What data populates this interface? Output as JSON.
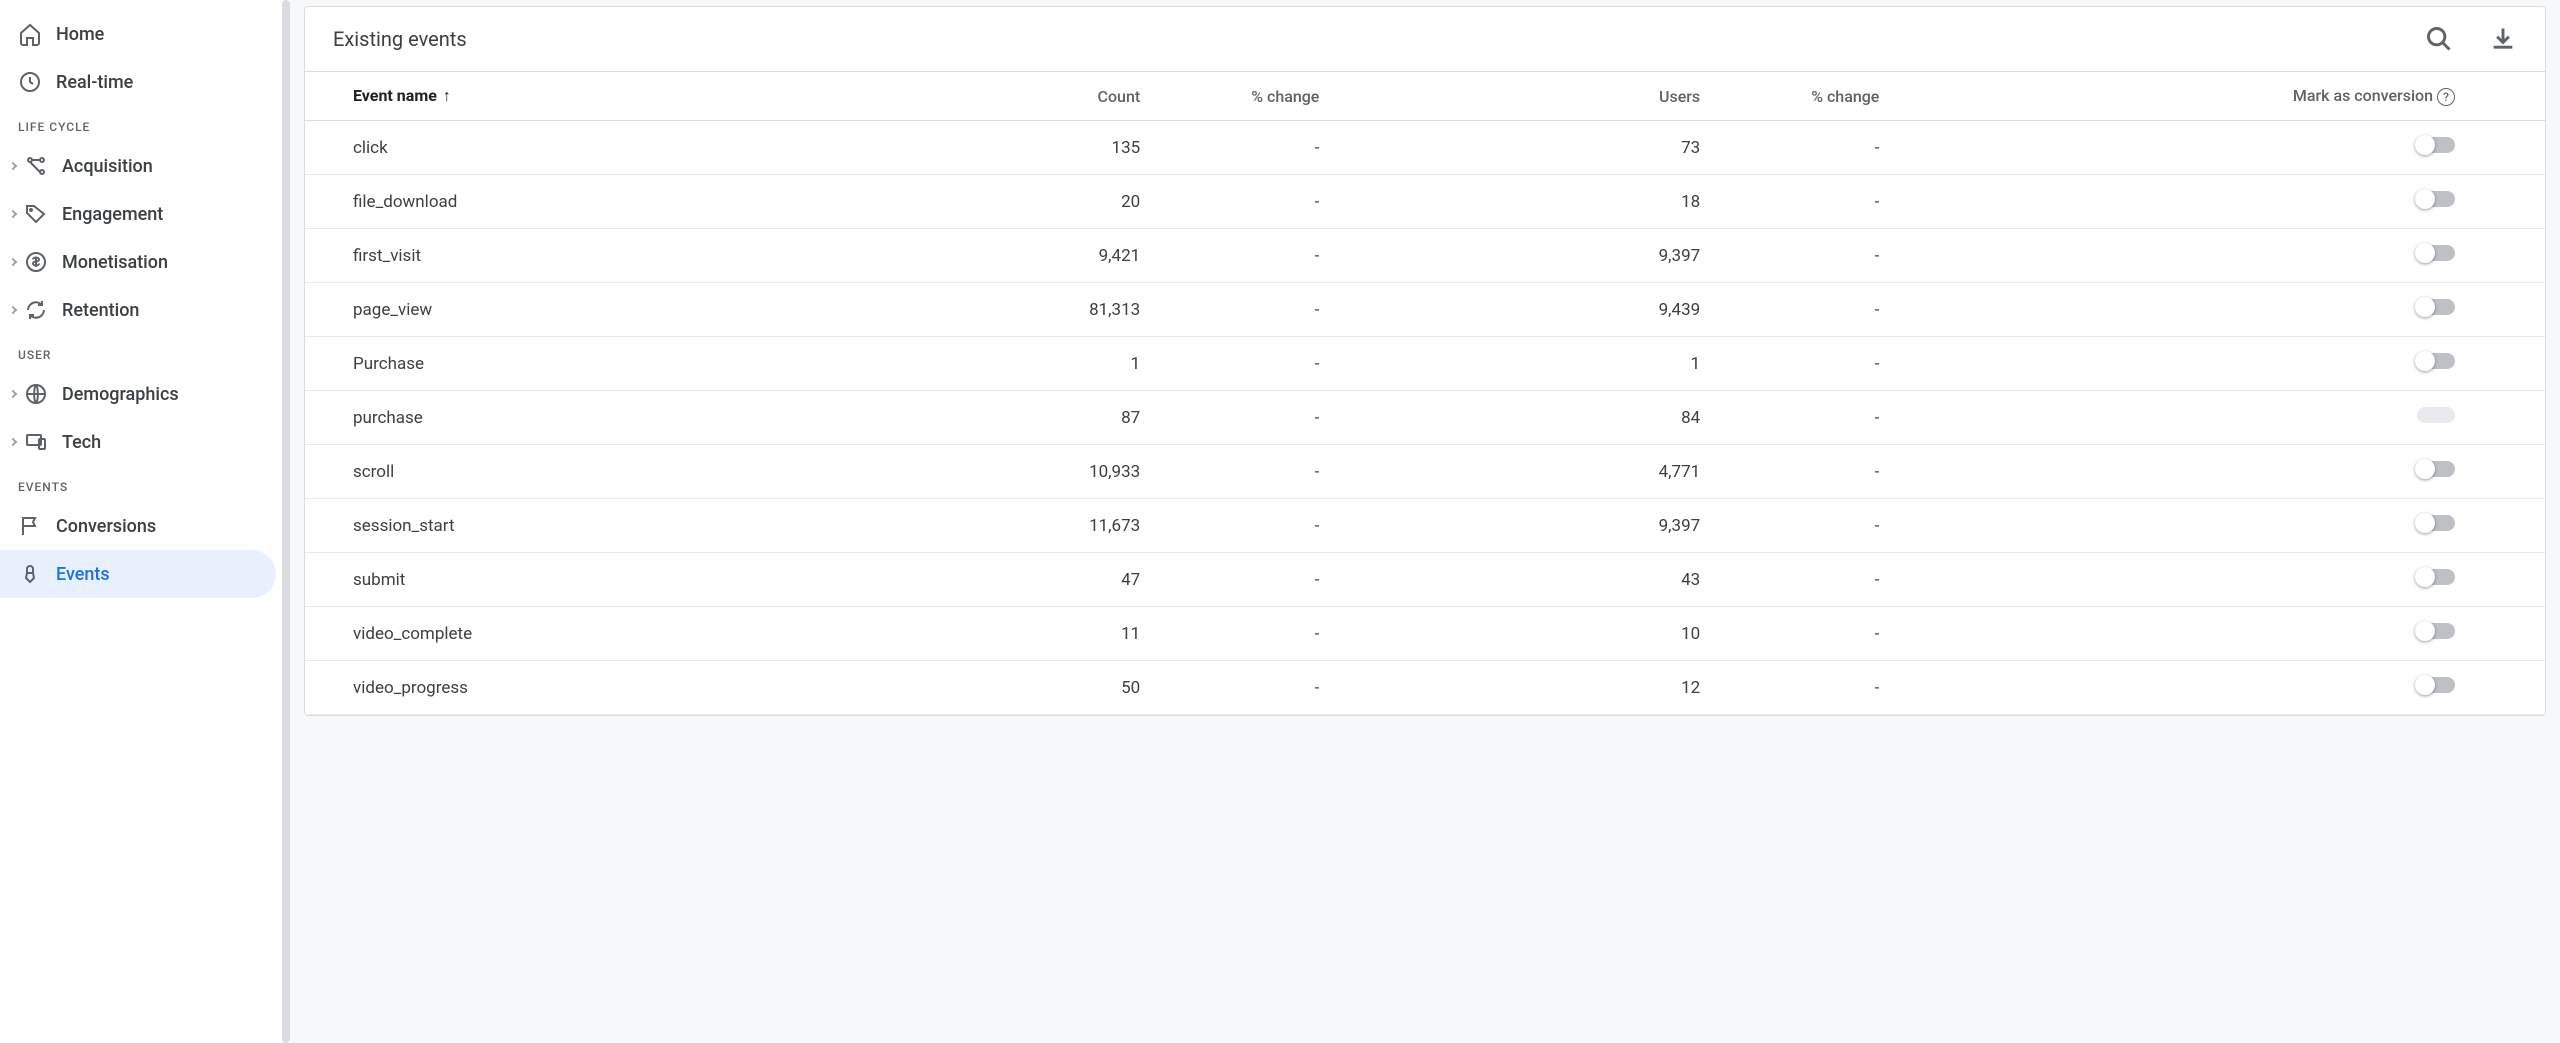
{
  "sidebar": {
    "home": "Home",
    "realtime": "Real-time",
    "sections": {
      "lifecycle": {
        "label": "LIFE CYCLE",
        "items": [
          "Acquisition",
          "Engagement",
          "Monetisation",
          "Retention"
        ]
      },
      "user": {
        "label": "USER",
        "items": [
          "Demographics",
          "Tech"
        ]
      },
      "events": {
        "label": "EVENTS",
        "items": [
          "Conversions",
          "Events"
        ]
      }
    }
  },
  "card": {
    "title": "Existing events",
    "columns": {
      "event_name": "Event name",
      "count": "Count",
      "pct_change1": "% change",
      "users": "Users",
      "pct_change2": "% change",
      "mark": "Mark as conversion"
    }
  },
  "rows": [
    {
      "name": "click",
      "count": "135",
      "c1": "-",
      "users": "73",
      "c2": "-",
      "toggle": "off"
    },
    {
      "name": "file_download",
      "count": "20",
      "c1": "-",
      "users": "18",
      "c2": "-",
      "toggle": "off"
    },
    {
      "name": "first_visit",
      "count": "9,421",
      "c1": "-",
      "users": "9,397",
      "c2": "-",
      "toggle": "off"
    },
    {
      "name": "page_view",
      "count": "81,313",
      "c1": "-",
      "users": "9,439",
      "c2": "-",
      "toggle": "off"
    },
    {
      "name": "Purchase",
      "count": "1",
      "c1": "-",
      "users": "1",
      "c2": "-",
      "toggle": "off"
    },
    {
      "name": "purchase",
      "count": "87",
      "c1": "-",
      "users": "84",
      "c2": "-",
      "toggle": "disabled"
    },
    {
      "name": "scroll",
      "count": "10,933",
      "c1": "-",
      "users": "4,771",
      "c2": "-",
      "toggle": "off"
    },
    {
      "name": "session_start",
      "count": "11,673",
      "c1": "-",
      "users": "9,397",
      "c2": "-",
      "toggle": "off"
    },
    {
      "name": "submit",
      "count": "47",
      "c1": "-",
      "users": "43",
      "c2": "-",
      "toggle": "off"
    },
    {
      "name": "video_complete",
      "count": "11",
      "c1": "-",
      "users": "10",
      "c2": "-",
      "toggle": "off"
    },
    {
      "name": "video_progress",
      "count": "50",
      "c1": "-",
      "users": "12",
      "c2": "-",
      "toggle": "off"
    }
  ]
}
